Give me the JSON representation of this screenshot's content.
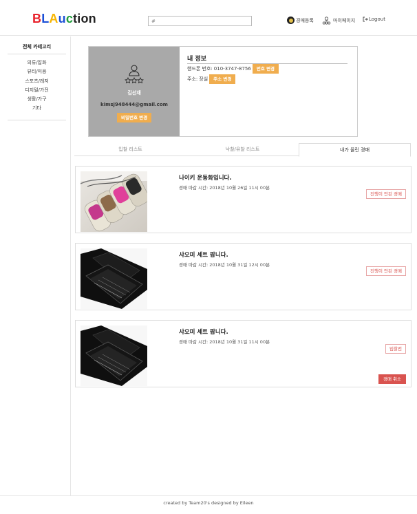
{
  "header": {
    "logo_letters": [
      {
        "ch": "B",
        "color": "#e8202a"
      },
      {
        "ch": "L",
        "color": "#1b4fd6"
      },
      {
        "ch": "A",
        "color": "#f7b500"
      },
      {
        "ch": "u",
        "color": "#1b4fd6"
      },
      {
        "ch": "c",
        "color": "#1f9e3b"
      },
      {
        "ch": "t",
        "color": "#222222"
      },
      {
        "ch": "i",
        "color": "#222222"
      },
      {
        "ch": "o",
        "color": "#222222"
      },
      {
        "ch": "n",
        "color": "#222222"
      }
    ],
    "search_value": "#",
    "nav_auction_label": "경매등록",
    "nav_mypage_label": "마이페이지",
    "nav_logout_label": "Logout"
  },
  "sidebar": {
    "title": "전체 카테고리",
    "items": [
      "의류/잡화",
      "뷰티/미용",
      "스포츠/레저",
      "디지털/가전",
      "생활/가구",
      "기타"
    ]
  },
  "profile": {
    "name": "김선재",
    "email": "kimsj948444@gmail.com",
    "change_password_label": "비밀번호 변경",
    "info_title": "내 정보",
    "phone_label": "핸드폰 번호:",
    "phone_value": "010-3747-8756",
    "change_phone_label": "번호 변경",
    "address_label": "주소:",
    "address_value": "장실",
    "change_address_label": "주소 변경"
  },
  "tabs": [
    "입찰 리스트",
    "낙찰/유찰 리스트",
    "내가 올린 경매"
  ],
  "items": [
    {
      "title": "나이키 운동화입니다.",
      "deadline": "경매 마감 시간: 2018년 10월 26일 11시 00분",
      "status": "진행이 안된 경매"
    },
    {
      "title": "샤오미 세트 팝니다.",
      "deadline": "경매 마감 시간: 2018년 10월 31일 12시 00분",
      "status": "진행이 안된 경매"
    },
    {
      "title": "샤오미 세트 팝니다.",
      "deadline": "경매 마감 시간: 2018년 10월 31일 11시 00분",
      "status": "입찰전",
      "cancel_label": "경매 취소"
    }
  ],
  "footer": {
    "text": "created by Team20's designed by Eileen"
  },
  "colors": {
    "accent_orange": "#f0ad4e",
    "danger_red": "#d9534f"
  }
}
